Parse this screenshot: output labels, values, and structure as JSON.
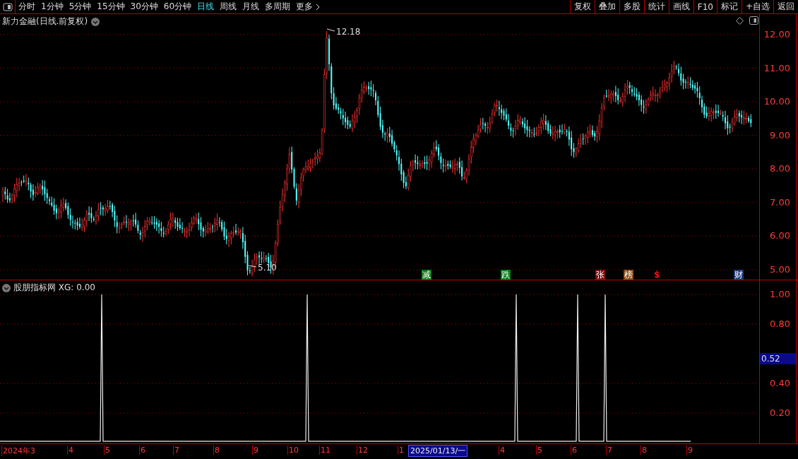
{
  "toolbar": {
    "periods": [
      {
        "label": "分时",
        "selected": false
      },
      {
        "label": "1分钟",
        "selected": false
      },
      {
        "label": "5分钟",
        "selected": false
      },
      {
        "label": "15分钟",
        "selected": false
      },
      {
        "label": "30分钟",
        "selected": false
      },
      {
        "label": "60分钟",
        "selected": false
      },
      {
        "label": "日线",
        "selected": true
      },
      {
        "label": "周线",
        "selected": false
      },
      {
        "label": "月线",
        "selected": false
      },
      {
        "label": "多周期",
        "selected": false
      },
      {
        "label": "更多",
        "selected": false
      }
    ],
    "buttons": [
      "复权",
      "叠加",
      "多股",
      "统计",
      "画线",
      "F10",
      "标记",
      "+自选",
      "返回"
    ]
  },
  "main_chart": {
    "title": "新力金融(日线.前复权)",
    "price_ticks": [
      "12.00",
      "11.00",
      "10.00",
      "9.00",
      "8.00",
      "7.00",
      "6.00",
      "5.00"
    ],
    "high_label": "12.18",
    "low_label": "5.10",
    "markers": [
      {
        "label": "减",
        "kind": "badge",
        "color": "#0b7a16"
      },
      {
        "label": "跌",
        "kind": "badge",
        "color": "#0b7a16"
      },
      {
        "label": "张",
        "kind": "badge",
        "color": "#7a0c0c"
      },
      {
        "label": "榜",
        "kind": "badge",
        "color": "#8a4a12"
      },
      {
        "label": "$",
        "kind": "text",
        "color": "#ee1111"
      },
      {
        "label": "财",
        "kind": "badge",
        "color": "#1c3a78"
      }
    ]
  },
  "indicator": {
    "title": "股朋指标网 XG: 0.00",
    "ticks": [
      "1.00",
      "0.80",
      "0.40",
      "0.20"
    ],
    "current_value": "0.52"
  },
  "date_axis": {
    "labels": [
      "2024年3",
      "4",
      "5",
      "6",
      "7",
      "8",
      "9",
      "10",
      "11",
      "12",
      "1",
      "4",
      "5",
      "6",
      "7",
      "8",
      "9"
    ],
    "cursor_date": "2025/01/13/一"
  }
}
